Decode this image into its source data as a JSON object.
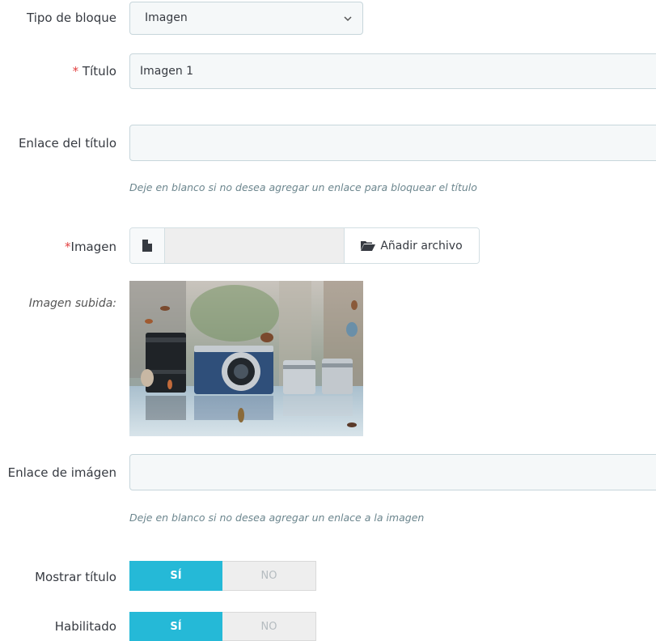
{
  "form": {
    "block_type": {
      "label": "Tipo de bloque",
      "value": "Imagen"
    },
    "title": {
      "required_mark": "*",
      "label": " Título",
      "value": "Imagen 1"
    },
    "title_link": {
      "label": "Enlace del título",
      "value": "",
      "help": "Deje en blanco si no desea agregar un enlace para bloquear el título"
    },
    "image": {
      "required_mark": "*",
      "label": "Imagen",
      "add_file_label": "Añadir archivo"
    },
    "uploaded_image": {
      "label": "Imagen subida:"
    },
    "image_link": {
      "label": "Enlace de imágen",
      "value": "",
      "help": "Deje en blanco si no desea agregar un enlace a la imagen"
    },
    "show_title": {
      "label": "Mostrar título",
      "yes": "SÍ",
      "no": "NO",
      "selected": "yes"
    },
    "enabled": {
      "label": "Habilitado",
      "yes": "SÍ",
      "no": "NO",
      "selected": "yes"
    }
  },
  "colors": {
    "accent": "#25b9d7",
    "required": "#e23f3f"
  },
  "icons": {
    "file": "file-icon",
    "folder": "folder-open-icon",
    "chevron": "chevron-down-icon"
  }
}
